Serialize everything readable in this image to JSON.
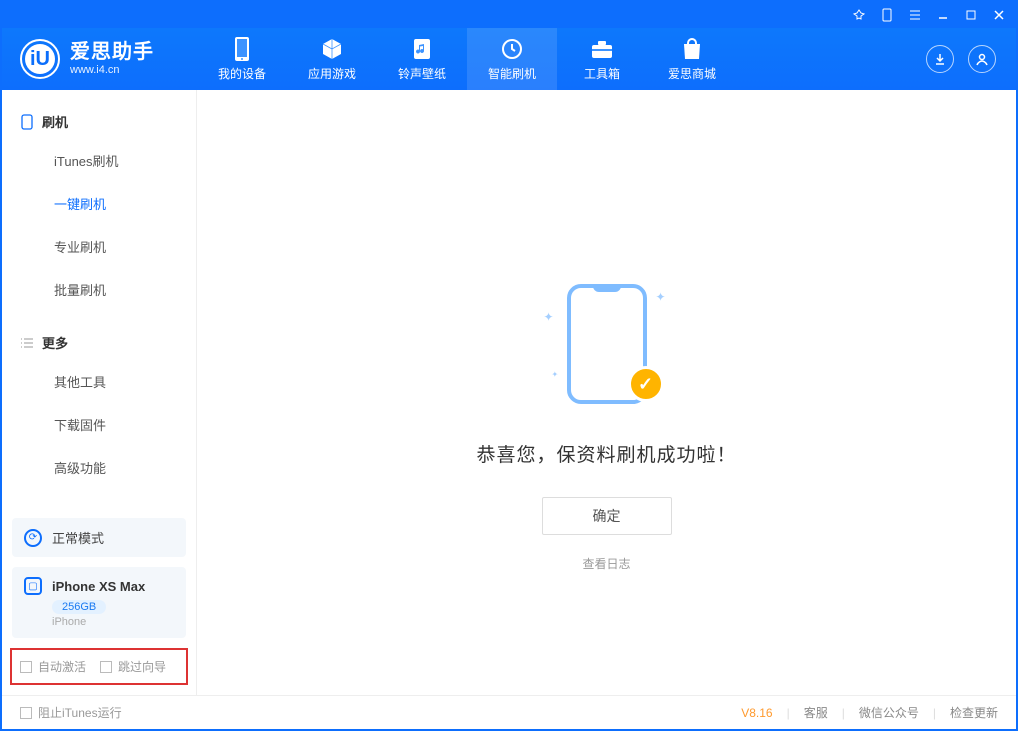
{
  "app": {
    "name": "爱思助手",
    "url": "www.i4.cn"
  },
  "nav": {
    "items": [
      {
        "label": "我的设备"
      },
      {
        "label": "应用游戏"
      },
      {
        "label": "铃声壁纸"
      },
      {
        "label": "智能刷机"
      },
      {
        "label": "工具箱"
      },
      {
        "label": "爱思商城"
      }
    ],
    "active_index": 3
  },
  "sidebar": {
    "sections": [
      {
        "title": "刷机",
        "items": [
          {
            "label": "iTunes刷机"
          },
          {
            "label": "一键刷机"
          },
          {
            "label": "专业刷机"
          },
          {
            "label": "批量刷机"
          }
        ],
        "active_index": 1
      },
      {
        "title": "更多",
        "items": [
          {
            "label": "其他工具"
          },
          {
            "label": "下载固件"
          },
          {
            "label": "高级功能"
          }
        ],
        "active_index": -1
      }
    ],
    "mode": "正常模式",
    "device": {
      "name": "iPhone XS Max",
      "storage": "256GB",
      "type": "iPhone"
    },
    "checkboxes": {
      "auto_activate": "自动激活",
      "skip_guide": "跳过向导"
    }
  },
  "main": {
    "message": "恭喜您，保资料刷机成功啦！",
    "confirm": "确定",
    "view_log": "查看日志"
  },
  "footer": {
    "block_itunes": "阻止iTunes运行",
    "version": "V8.16",
    "links": [
      "客服",
      "微信公众号",
      "检查更新"
    ]
  }
}
